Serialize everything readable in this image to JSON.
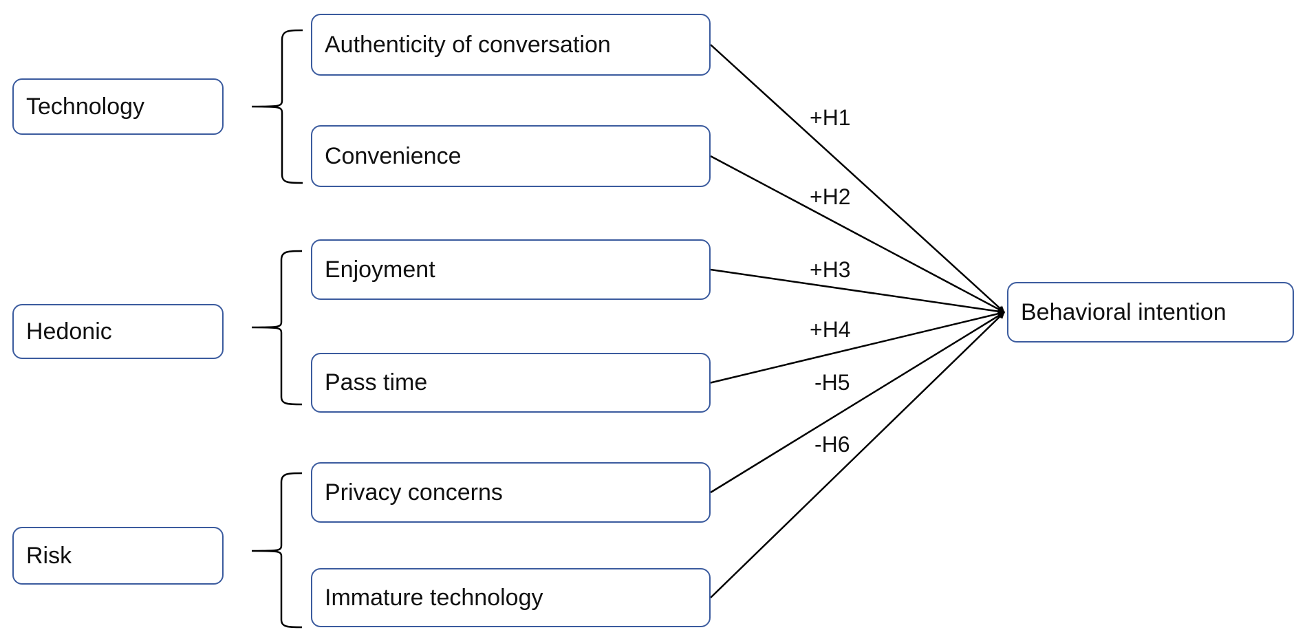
{
  "diagram": {
    "categories": [
      {
        "id": "technology",
        "label": "Technology"
      },
      {
        "id": "hedonic",
        "label": "Hedonic"
      },
      {
        "id": "risk",
        "label": "Risk"
      }
    ],
    "factors": [
      {
        "id": "authenticity",
        "label": "Authenticity of conversation",
        "category": "technology"
      },
      {
        "id": "convenience",
        "label": "Convenience",
        "category": "technology"
      },
      {
        "id": "enjoyment",
        "label": "Enjoyment",
        "category": "hedonic"
      },
      {
        "id": "pass-time",
        "label": "Pass time",
        "category": "hedonic"
      },
      {
        "id": "privacy",
        "label": "Privacy concerns",
        "category": "risk"
      },
      {
        "id": "immature",
        "label": "Immature technology",
        "category": "risk"
      }
    ],
    "outcome": {
      "id": "behavioral-intention",
      "label": "Behavioral intention"
    },
    "hypotheses": [
      {
        "id": "H1",
        "label": "+H1",
        "from": "authenticity",
        "sign": "+"
      },
      {
        "id": "H2",
        "label": "+H2",
        "from": "convenience",
        "sign": "+"
      },
      {
        "id": "H3",
        "label": "+H3",
        "from": "enjoyment",
        "sign": "+"
      },
      {
        "id": "H4",
        "label": "+H4",
        "from": "pass-time",
        "sign": "+"
      },
      {
        "id": "H5",
        "label": "-H5",
        "from": "privacy",
        "sign": "-"
      },
      {
        "id": "H6",
        "label": "-H6",
        "from": "immature",
        "sign": "-"
      }
    ],
    "colors": {
      "box_border": "#3b5b9e",
      "line": "#000000",
      "text": "#111111"
    }
  }
}
